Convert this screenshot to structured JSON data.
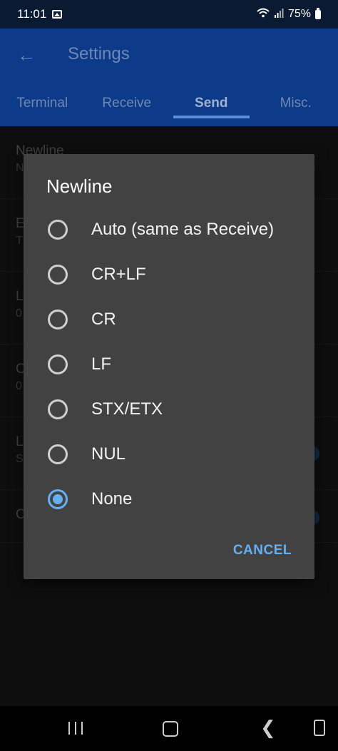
{
  "status_bar": {
    "time": "11:01",
    "battery": "75%"
  },
  "appbar": {
    "title": "Settings",
    "back_icon": "arrow-left-icon"
  },
  "tabs": [
    {
      "label": "Terminal"
    },
    {
      "label": "Receive"
    },
    {
      "label": "Send",
      "active": true
    },
    {
      "label": "Misc."
    }
  ],
  "background_list": [
    {
      "title": "Newline",
      "subtitle": "N"
    },
    {
      "title": "E",
      "subtitle": "T"
    },
    {
      "title": "L",
      "subtitle": "0"
    },
    {
      "title": "C",
      "subtitle": "0"
    },
    {
      "title": "L",
      "subtitle": "S"
    },
    {
      "title": "C",
      "subtitle": ""
    }
  ],
  "dialog": {
    "title": "Newline",
    "options": [
      {
        "label": "Auto (same as Receive)",
        "checked": false
      },
      {
        "label": "CR+LF",
        "checked": false
      },
      {
        "label": "CR",
        "checked": false
      },
      {
        "label": "LF",
        "checked": false
      },
      {
        "label": "STX/ETX",
        "checked": false
      },
      {
        "label": "NUL",
        "checked": false
      },
      {
        "label": "None",
        "checked": true
      }
    ],
    "cancel_label": "CANCEL"
  },
  "colors": {
    "accent": "#66aff0",
    "appbar": "#0d3b8a",
    "dialog_bg": "#424242"
  }
}
